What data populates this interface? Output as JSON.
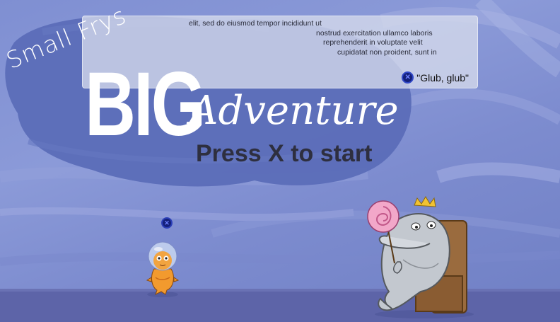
{
  "dialog": {
    "text_lines": [
      "elit, sed do eiusmod tempor incididunt ut",
      "nostrud exercitation ullamco laboris",
      "reprehenderit in voluptate velit",
      "cupidatat non proident, sunt in"
    ],
    "choice_button_icon": "x-button-icon",
    "choice_label": "\"Glub, glub\""
  },
  "title": {
    "small": "Small Frys",
    "big": "BIG",
    "adventure": "Adventure"
  },
  "prompt": "Press X to start",
  "player_marker_icon": "x-button-icon",
  "colors": {
    "background": "#8b9ad8",
    "cloud": "#5b6db8",
    "floor": "#5d64a8",
    "title": "#ffffff",
    "prompt": "#2e2f3f",
    "button": "#14207a"
  }
}
